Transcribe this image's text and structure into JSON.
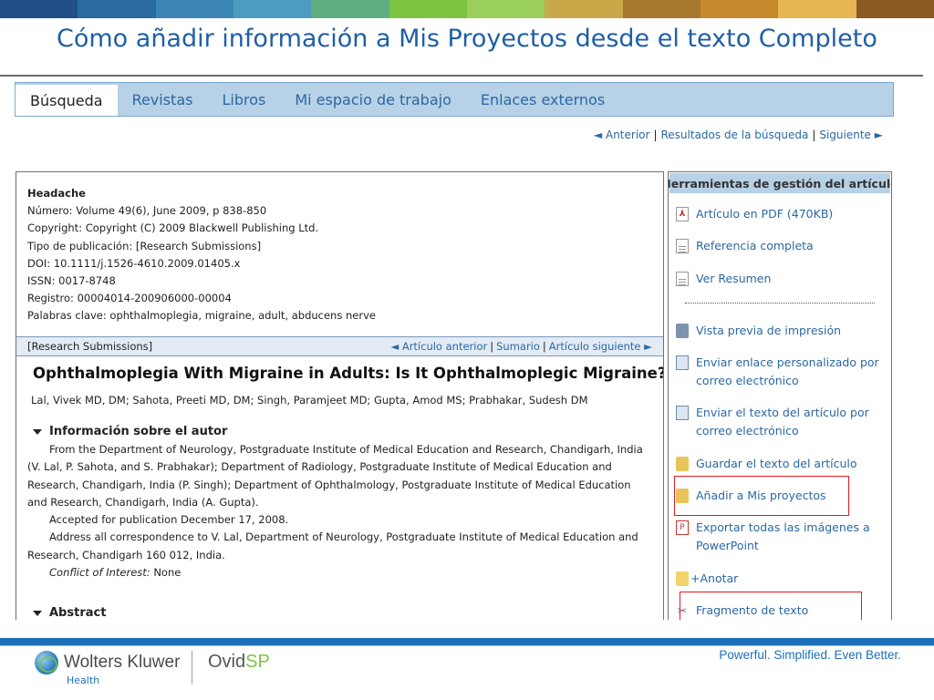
{
  "slide": {
    "title": "Cómo añadir información a Mis Proyectos desde el texto Completo"
  },
  "colors": {
    "title": "#1f5fa6",
    "link": "#2a68a3",
    "nav_bar": "#b7d1e6",
    "highlight_box": "#e11b22",
    "brand_blue": "#1d6fb8",
    "brand_green": "#7ec242"
  },
  "nav": {
    "tabs": [
      "Búsqueda",
      "Revistas",
      "Libros",
      "Mi espacio de trabajo",
      "Enlaces externos"
    ],
    "active": "Búsqueda"
  },
  "pager": {
    "prev": "◄ Anterior",
    "results": "Resultados de la búsqueda",
    "next": "Siguiente ►",
    "sep": "|"
  },
  "article": {
    "meta": [
      "Headache",
      "Número: Volume 49(6), June 2009, p 838-850",
      "Copyright: Copyright (C) 2009 Blackwell Publishing Ltd.",
      "Tipo de publicación: [Research Submissions]",
      "DOI: 10.1111/j.1526-4610.2009.01405.x",
      "ISSN: 0017-8748",
      "Registro: 00004014-200906000-00004",
      "Palabras clave: ophthalmoplegia, migraine, adult, abducens nerve"
    ],
    "section_label": "[Research Submissions]",
    "section_nav": {
      "prev": "◄ Artículo anterior",
      "summary": "Sumario",
      "next": "Artículo siguiente ►"
    },
    "title": "Ophthalmoplegia With Migraine in Adults: Is It Ophthalmoplegic Migraine?",
    "authors": "Lal, Vivek MD, DM; Sahota, Preeti MD, DM; Singh, Paramjeet MD; Gupta, Amod MS; Prabhakar, Sudesh DM",
    "author_info_heading": "Información sobre el autor",
    "affiliation": "From the Department of Neurology, Postgraduate Institute of Medical Education and Research, Chandigarh, India (V. Lal, P. Sahota, and S. Prabhakar); Department of Radiology, Postgraduate Institute of Medical Education and Research, Chandigarh, India (P. Singh); Department of Ophthalmology, Postgraduate Institute of Medical Education and Research, Chandigarh, India (A. Gupta).",
    "accepted": "Accepted for publication December 17, 2008.",
    "correspondence": "Address all correspondence to V. Lal, Department of Neurology, Postgraduate Institute of Medical Education and Research, Chandigarh 160 012, India.",
    "conflict_label": "Conflict of Interest:",
    "conflict_value": "None",
    "abstract_heading": "Abstract"
  },
  "tools": {
    "heading": "Herramientas de gestión del artículo",
    "items": [
      {
        "label": "Artículo en PDF",
        "extra": "(470KB)",
        "icon": "pdf-icon"
      },
      {
        "label": "Referencia completa",
        "icon": "document-icon"
      },
      {
        "label": "Ver Resumen",
        "icon": "document-icon"
      },
      {
        "label": "Vista previa de impresión",
        "icon": "printer-icon"
      },
      {
        "label": "Enviar enlace personalizado por",
        "label2": "correo electrónico",
        "icon": "email-link-icon"
      },
      {
        "label": "Enviar el texto del artículo por",
        "label2": "correo electrónico",
        "icon": "email-icon"
      },
      {
        "label": "Guardar el texto del artículo",
        "icon": "save-icon"
      },
      {
        "label": "Añadir a Mis proyectos",
        "icon": "folder-add-icon"
      },
      {
        "label": "Exportar todas las imágenes a",
        "label2": "PowerPoint",
        "icon": "powerpoint-icon"
      },
      {
        "label": "+Anotar",
        "icon": "annotate-icon"
      },
      {
        "label": "Fragmento de texto",
        "icon": "scissors-icon"
      }
    ]
  },
  "footer": {
    "brand": "Wolters Kluwer",
    "brand_sub": "Health",
    "product": "Ovid",
    "product_suffix": "SP",
    "tagline": "Powerful. Simplified. Even Better."
  }
}
